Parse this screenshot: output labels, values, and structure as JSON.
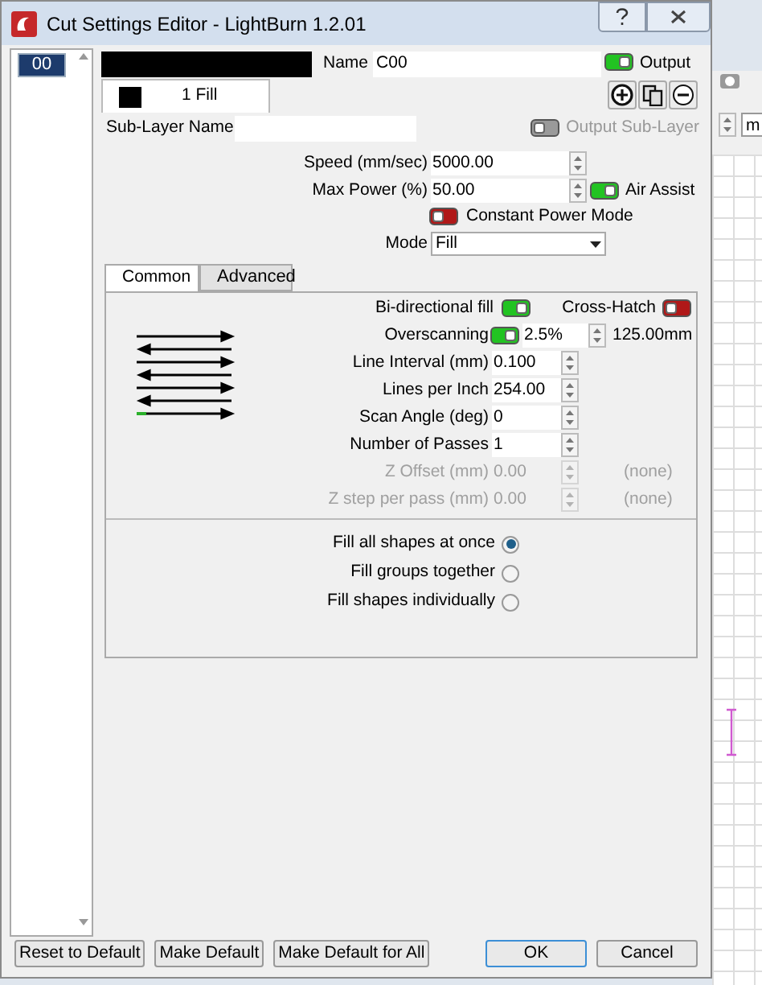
{
  "window": {
    "title": "Cut Settings Editor - LightBurn 1.2.01"
  },
  "layers": [
    {
      "label": "00",
      "selected": true
    }
  ],
  "layer": {
    "color": "#000000",
    "name_label": "Name",
    "name": "C00"
  },
  "output": {
    "label": "Output",
    "on": true
  },
  "sublayers": [
    {
      "label": "1 Fill",
      "color": "#000000",
      "selected": true
    }
  ],
  "sublayer_name": {
    "label": "Sub-Layer Name"
  },
  "output_sublayer": {
    "label": "Output Sub-Layer",
    "on": false,
    "disabled": true
  },
  "speed": {
    "label": "Speed (mm/sec)",
    "value": "5000.00"
  },
  "max_power": {
    "label": "Max Power (%)",
    "value": "50.00"
  },
  "air_assist": {
    "label": "Air Assist",
    "on": true
  },
  "constant_power": {
    "label": "Constant Power Mode",
    "on": false
  },
  "mode": {
    "label": "Mode",
    "value": "Fill"
  },
  "tabs": [
    {
      "label": "Common",
      "selected": true
    },
    {
      "label": "Advanced",
      "selected": false
    }
  ],
  "bidirectional": {
    "label": "Bi-directional fill",
    "on": true
  },
  "cross_hatch": {
    "label": "Cross-Hatch",
    "on": false
  },
  "fields": [
    {
      "kind": "toggle",
      "label": "Overscanning",
      "on": true,
      "value": "2.5%",
      "note": "125.00mm",
      "disabled": false
    },
    {
      "kind": "plain",
      "label": "Line Interval (mm)",
      "value": "0.100",
      "disabled": false
    },
    {
      "kind": "plain",
      "label": "Lines per Inch",
      "value": "254.00",
      "disabled": false
    },
    {
      "kind": "plain",
      "label": "Scan Angle (deg)",
      "value": "0",
      "disabled": false
    },
    {
      "kind": "plain",
      "label": "Number of Passes",
      "value": "1",
      "disabled": false
    },
    {
      "kind": "plain",
      "label": "Z Offset (mm)",
      "value": "0.00",
      "note": "(none)",
      "disabled": true
    },
    {
      "kind": "plain",
      "label": "Z step per pass (mm)",
      "value": "0.00",
      "note": "(none)",
      "disabled": true
    }
  ],
  "fill_options": [
    {
      "label": "Fill all shapes at once",
      "selected": true
    },
    {
      "label": "Fill groups together",
      "selected": false
    },
    {
      "label": "Fill shapes individually",
      "selected": false
    }
  ],
  "buttons": [
    {
      "label": "Reset to Default",
      "kind": "left"
    },
    {
      "label": "Make Default",
      "kind": "left"
    },
    {
      "label": "Make Default for All",
      "kind": "left"
    },
    {
      "label": "OK",
      "kind": "default"
    },
    {
      "label": "Cancel",
      "kind": "right"
    }
  ],
  "background_app": {
    "unit": "m"
  }
}
